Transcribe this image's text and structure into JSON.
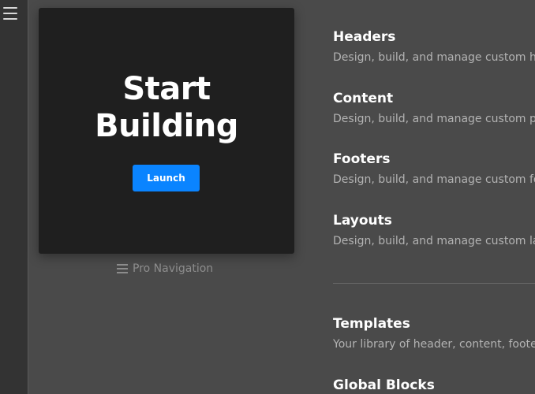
{
  "sidebar": {
    "menu_icon": "hamburger-menu-icon"
  },
  "hero": {
    "title_line1": "Start",
    "title_line2": "Building",
    "launch_label": "Launch",
    "accent_color": "#0a84ff"
  },
  "caption": {
    "icon": "hamburger-menu-icon",
    "label": "Pro Navigation"
  },
  "nav": {
    "items": [
      {
        "title": "Headers",
        "desc": "Design, build, and manage custom he"
      },
      {
        "title": "Content",
        "desc": "Design, build, and manage custom pa"
      },
      {
        "title": "Footers",
        "desc": "Design, build, and manage custom fo"
      },
      {
        "title": "Layouts",
        "desc": "Design, build, and manage custom lay"
      },
      {
        "title": "Templates",
        "desc": "Your library of header, content, footer"
      },
      {
        "title": "Global Blocks",
        "desc": ""
      }
    ]
  }
}
